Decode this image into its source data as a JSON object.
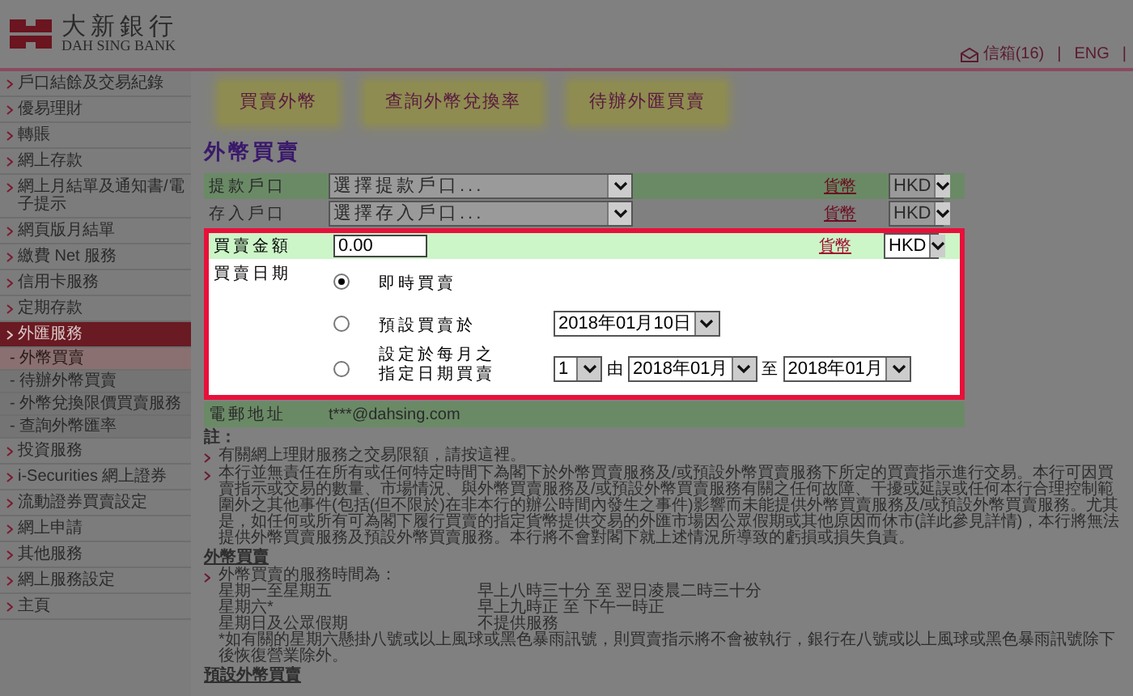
{
  "header": {
    "logo_cn": "大新銀行",
    "logo_en": "DAH SING BANK",
    "inbox": "信箱(16)",
    "links": [
      "|",
      "ENG",
      "|"
    ]
  },
  "sidebar": {
    "items": [
      {
        "label": "戶口結餘及交易紀錄",
        "selected": false
      },
      {
        "label": "優易理財",
        "selected": false
      },
      {
        "label": "轉賬",
        "selected": false
      },
      {
        "label": "網上存款",
        "selected": false
      },
      {
        "label": "網上月結單及通知書/電子提示",
        "selected": false
      },
      {
        "label": "網頁版月結單",
        "selected": false
      },
      {
        "label": "繳費 Net 服務",
        "selected": false
      },
      {
        "label": "信用卡服務",
        "selected": false
      },
      {
        "label": "定期存款",
        "selected": false
      },
      {
        "label": "外匯服務",
        "selected": true,
        "expanded": true,
        "children": [
          {
            "label": "- 外幣買賣",
            "selected": true
          },
          {
            "label": "- 待辦外幣買賣",
            "selected": false
          },
          {
            "label": "- 外幣兌換限價買賣服務",
            "selected": false
          },
          {
            "label": "- 查詢外幣匯率",
            "selected": false
          }
        ]
      },
      {
        "label": "投資服務",
        "selected": false
      },
      {
        "label": "i-Securities 網上證券",
        "selected": false
      },
      {
        "label": "流動證券買賣設定",
        "selected": false
      },
      {
        "label": "網上申請",
        "selected": false
      },
      {
        "label": "其他服務",
        "selected": false
      },
      {
        "label": "網上服務設定",
        "selected": false
      },
      {
        "label": "主頁",
        "selected": false
      }
    ]
  },
  "tabs": [
    "買賣外幣",
    "查詢外幣兌換率",
    "待辦外匯買賣"
  ],
  "form": {
    "title": "外幣買賣",
    "withdraw": {
      "label": "提款戶口",
      "value": "選擇提款戶口...",
      "link": "貨幣",
      "currency": "HKD"
    },
    "deposit": {
      "label": "存入戶口",
      "value": "選擇存入戶口...",
      "link": "貨幣",
      "currency": "HKD"
    },
    "amount": {
      "label": "買賣金額",
      "value": "0.00",
      "link": "貨幣",
      "currency": "HKD"
    },
    "date": {
      "label": "買賣日期",
      "options": [
        {
          "kind": "now",
          "label": "即時買賣",
          "selected": true
        },
        {
          "kind": "scheduled",
          "label": "預設買賣於",
          "selected": false,
          "date": "2018年01月10日"
        },
        {
          "kind": "monthly",
          "label": "設定於每月之指定日期買賣",
          "selected": false,
          "day": "1",
          "from_label": "由",
          "from": "2018年01月",
          "to_label": "至",
          "to": "2018年01月"
        }
      ]
    },
    "email": {
      "label": "電郵地址",
      "value": "t***@dahsing.com"
    }
  },
  "notes": {
    "title": "註：",
    "items": [
      "有關網上理財服務之交易限額，請按這裡。",
      "本行並無責任在所有或任何特定時間下為閣下於外幣買賣服務及/或預設外幣買賣服務下所定的買賣指示進行交易。本行可因買賣指示或交易的數量、市場情況、與外幣買賣服務及/或預設外幣買賣服務有關之任何故障、干擾或延誤或任何本行合理控制範圍外之其他事件(包括(但不限於)在非本行的辦公時間內發生之事件)影響而未能提供外幣買賣服務及/或預設外幣買賣服務。尤其是，如任何或所有可為閣下履行買賣的指定貨幣提供交易的外匯市場因公眾假期或其他原因而休市(詳此參見詳情)，本行將無法提供外幣買賣服務及預設外幣買賣服務。本行將不會對閣下就上述情況所導致的虧損或損失負責。"
    ]
  },
  "hours": {
    "title": "外幣買賣",
    "intro": "外幣買賣的服務時間為：",
    "rows": [
      [
        "星期一至星期五",
        "早上八時三十分 至 翌日凌晨二時三十分"
      ],
      [
        "星期六*",
        "早上九時正 至 下午一時正"
      ],
      [
        "星期日及公眾假期",
        "不提供服務"
      ]
    ],
    "footnote": "*如有關的星期六懸掛八號或以上風球或黑色暴雨訊號，則買賣指示將不會被執行，銀行在八號或以上風球或黑色暴雨訊號除下後恢復營業除外。"
  },
  "next_heading": "預設外幣買賣"
}
